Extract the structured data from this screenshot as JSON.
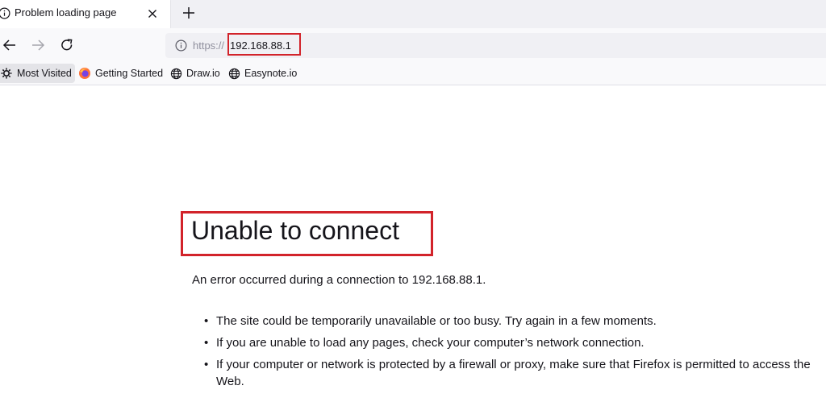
{
  "tab": {
    "title": "Problem loading page",
    "new_tab_icon": "plus-icon",
    "close_icon": "close-icon",
    "info_icon": "info-icon"
  },
  "navbar": {
    "back_icon": "arrow-left-icon",
    "forward_icon": "arrow-right-icon",
    "reload_icon": "reload-icon",
    "url_scheme": "https://",
    "url_host": "192.168.88.1"
  },
  "bookmarks": [
    {
      "label": "Most Visited",
      "icon": "gear-icon"
    },
    {
      "label": "Getting Started",
      "icon": "firefox-icon"
    },
    {
      "label": "Draw.io",
      "icon": "globe-icon"
    },
    {
      "label": "Easynote.io",
      "icon": "globe-icon"
    }
  ],
  "error": {
    "title": "Unable to connect",
    "description": "An error occurred during a connection to 192.168.88.1.",
    "suggestions": [
      "The site could be temporarily unavailable or too busy. Try again in a few moments.",
      "If you are unable to load any pages, check your computer’s network connection.",
      "If your computer or network is protected by a firewall or proxy, make sure that Firefox is permitted to access the Web."
    ]
  },
  "colors": {
    "highlight": "#d2232a",
    "tabstrip": "#f0f0f4",
    "toolbar": "#f9f9fb"
  }
}
